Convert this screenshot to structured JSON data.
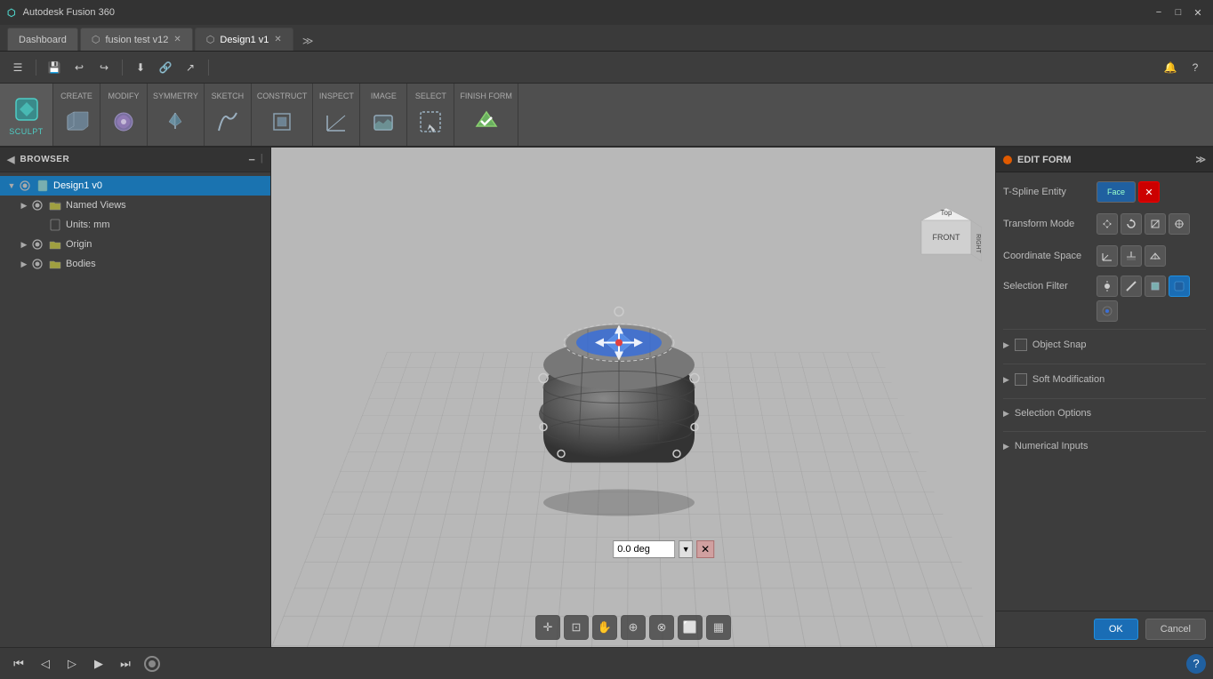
{
  "app": {
    "title": "Autodesk Fusion 360",
    "minimize_label": "−",
    "restore_label": "□",
    "close_label": "✕"
  },
  "tabs": [
    {
      "id": "dashboard",
      "label": "Dashboard",
      "active": false
    },
    {
      "id": "fusion-test",
      "label": "fusion test v12",
      "active": false,
      "closable": true
    },
    {
      "id": "design1",
      "label": "Design1 v1",
      "active": true,
      "closable": true
    }
  ],
  "quick_toolbar": {
    "buttons": [
      "☰",
      "💾",
      "↩",
      "↪",
      "⬇",
      "🔗",
      "↗"
    ]
  },
  "ribbon": {
    "active_workspace": "SCULPT",
    "sections": [
      {
        "id": "sculpt",
        "label": "SCULPT",
        "active": true
      },
      {
        "id": "create",
        "label": "CREATE",
        "active": false
      },
      {
        "id": "modify",
        "label": "MODIFY",
        "active": false
      },
      {
        "id": "symmetry",
        "label": "SYMMETRY",
        "active": false
      },
      {
        "id": "sketch",
        "label": "SKETCH",
        "active": false
      },
      {
        "id": "construct",
        "label": "CONSTRUCT",
        "active": false
      },
      {
        "id": "inspect",
        "label": "INSPECT",
        "active": false
      },
      {
        "id": "image",
        "label": "IMAGE",
        "active": false
      },
      {
        "id": "select",
        "label": "SELECT",
        "active": false
      },
      {
        "id": "finish-form",
        "label": "FINISH FORM",
        "active": false
      }
    ]
  },
  "browser": {
    "title": "BROWSER",
    "tree": [
      {
        "id": "design1",
        "label": "Design1 v0",
        "indent": 0,
        "expanded": true,
        "icon": "doc",
        "visible": true,
        "selected": true
      },
      {
        "id": "named-views",
        "label": "Named Views",
        "indent": 1,
        "expanded": false,
        "icon": "folder",
        "visible": true
      },
      {
        "id": "units",
        "label": "Units: mm",
        "indent": 1,
        "expanded": false,
        "icon": "page",
        "visible": false
      },
      {
        "id": "origin",
        "label": "Origin",
        "indent": 1,
        "expanded": false,
        "icon": "folder",
        "visible": true
      },
      {
        "id": "bodies",
        "label": "Bodies",
        "indent": 1,
        "expanded": false,
        "icon": "folder",
        "visible": true
      }
    ]
  },
  "edit_form": {
    "title": "EDIT FORM",
    "t_spline_entity_label": "T-Spline Entity",
    "transform_mode_label": "Transform Mode",
    "coordinate_space_label": "Coordinate Space",
    "selection_filter_label": "Selection Filter",
    "object_snap_label": "Object Snap",
    "soft_modification_label": "Soft Modification",
    "selection_options_label": "Selection Options",
    "numerical_inputs_label": "Numerical Inputs",
    "ok_label": "OK",
    "cancel_label": "Cancel"
  },
  "viewport": {
    "angle_value": "0.0 deg"
  },
  "bottom_nav": {
    "buttons": [
      "✛",
      "⊡",
      "✋",
      "⊕",
      "⊗",
      "⬜",
      "▦"
    ]
  },
  "status_bar": {
    "left_buttons": [
      "◀",
      "◁",
      "▷",
      "▶",
      "⏭"
    ],
    "help_icon": "?"
  }
}
